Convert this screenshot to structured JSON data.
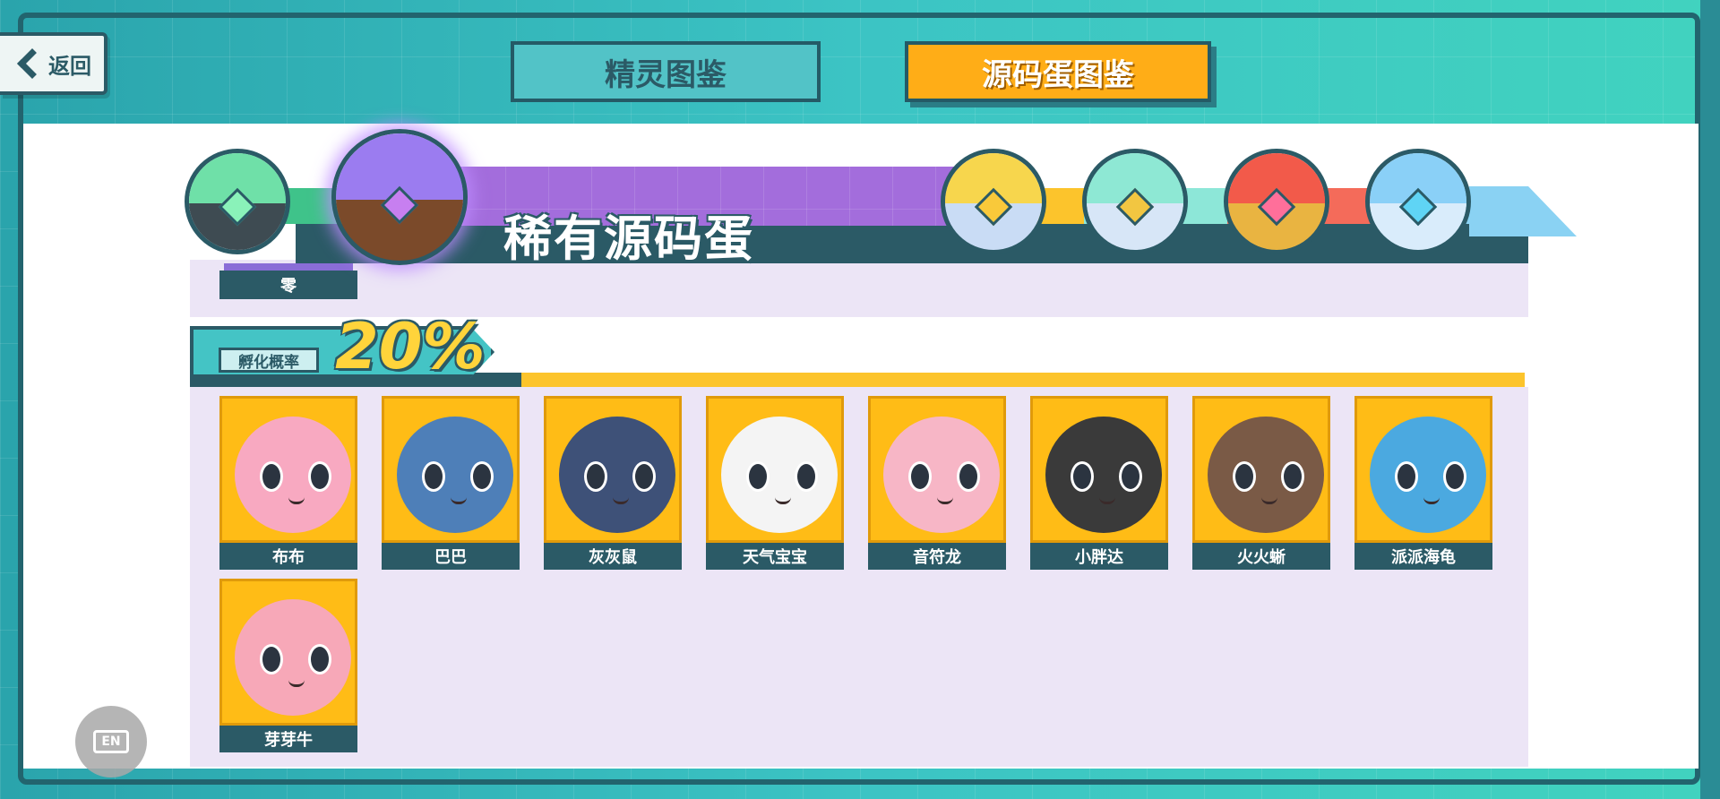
{
  "header": {
    "back_label": "返回",
    "tabs": [
      {
        "label": "精灵图鉴",
        "active": false
      },
      {
        "label": "源码蛋图鉴",
        "active": true
      }
    ]
  },
  "banner": {
    "title": "稀有源码蛋",
    "eggs": [
      {
        "name": "green-egg",
        "top_color": "#6fe0a8",
        "bottom_color": "#3e4b52",
        "gem_color": "#8af2b9"
      },
      {
        "name": "purple-egg",
        "top_color": "#9b7cf0",
        "bottom_color": "#7b4a2a",
        "gem_color": "#c77ff0",
        "selected": true
      },
      {
        "name": "gold-egg",
        "top_color": "#f7d64d",
        "bottom_color": "#c9dcf5",
        "gem_color": "#f9c93a"
      },
      {
        "name": "rainbow-egg",
        "top_color": "#8ee8d4",
        "bottom_color": "#d7e6f7",
        "gem_color": "#f2c641"
      },
      {
        "name": "red-egg",
        "top_color": "#f25a4a",
        "bottom_color": "#e9b441",
        "gem_color": "#ff6f9a"
      },
      {
        "name": "blue-egg",
        "top_color": "#8ad0f7",
        "bottom_color": "#d9ecfb",
        "gem_color": "#5fd4f5"
      }
    ]
  },
  "partial_row": {
    "label": "零"
  },
  "hatch": {
    "label": "孵化概率",
    "value": "20%"
  },
  "pets": [
    {
      "name": "布布",
      "color": "#f8a9c1"
    },
    {
      "name": "巴巴",
      "color": "#4e7fb8"
    },
    {
      "name": "灰灰鼠",
      "color": "#3e5178"
    },
    {
      "name": "天气宝宝",
      "color": "#f4f4f4"
    },
    {
      "name": "音符龙",
      "color": "#f7b6c6"
    },
    {
      "name": "小胖达",
      "color": "#3a3a3a"
    },
    {
      "name": "火火蜥",
      "color": "#7a5a46"
    },
    {
      "name": "派派海龟",
      "color": "#4ba9e0"
    },
    {
      "name": "芽芽牛",
      "color": "#f7a8b8"
    }
  ],
  "lang_button": "EN",
  "colors": {
    "frame": "#2f9fa3",
    "accent": "#ffad17",
    "dark": "#2b5a66",
    "card_bg": "#ffbc16",
    "panel_lavender": "#ece5f6"
  }
}
